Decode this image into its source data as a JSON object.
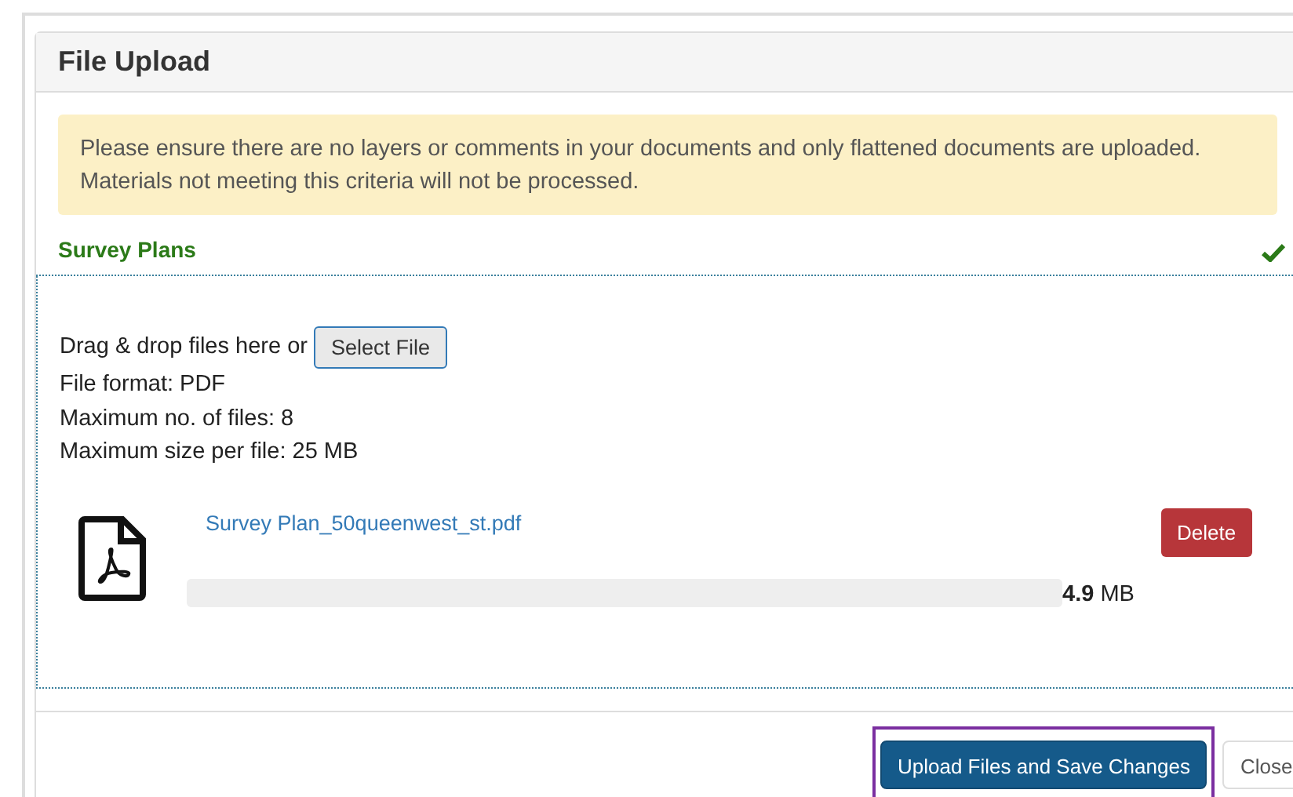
{
  "dialog": {
    "title": "File Upload"
  },
  "alert": {
    "lines": [
      "Please ensure there are no layers or comments in your documents and only flattened documents are uploaded.",
      "Materials not meeting this criteria will not be processed."
    ]
  },
  "section": {
    "title": "Survey Plans",
    "complete": true
  },
  "dropzone": {
    "prompt": "Drag & drop files here or",
    "select_button": "Select File",
    "info": [
      "File format: PDF",
      "Maximum no. of files: 8",
      "Maximum size per file: 25 MB"
    ]
  },
  "files": [
    {
      "name": "Survey Plan_50queenwest_st.pdf",
      "delete_button": "Delete",
      "level": 1,
      "size_value": "4.9",
      "size_unit": "MB"
    }
  ],
  "footer": {
    "buttons": [
      {
        "label": "Upload Files and Save Changes",
        "kind": "primary",
        "highlighted": true
      },
      {
        "label": "Close",
        "kind": "default",
        "highlighted": false
      }
    ]
  }
}
